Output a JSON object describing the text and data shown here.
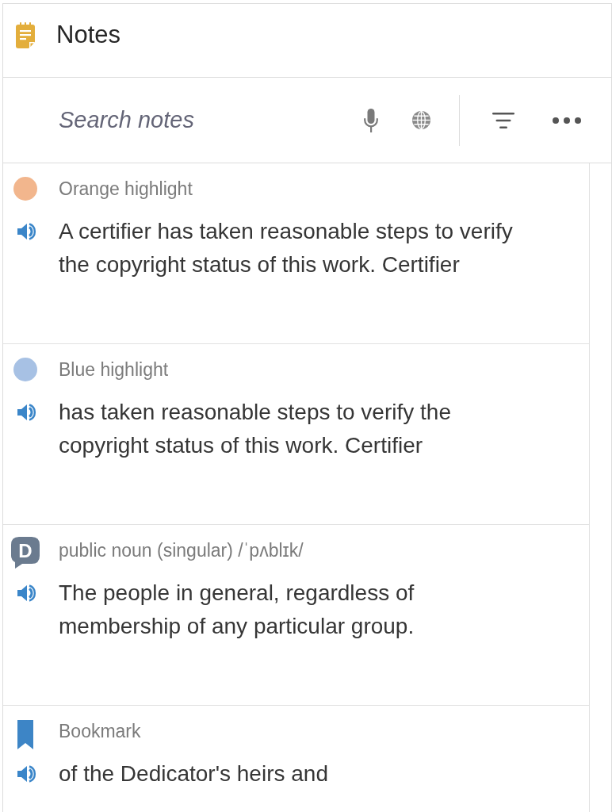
{
  "header": {
    "title": "Notes"
  },
  "search": {
    "placeholder": "Search notes"
  },
  "notes": [
    {
      "kind": "highlight",
      "color": "#f2b68d",
      "label": "Orange highlight",
      "text": "A certifier has taken reasonable steps to verify the copyright status of this work. Certifier"
    },
    {
      "kind": "highlight",
      "color": "#a7c1e4",
      "label": "Blue highlight",
      "text": "has taken reasonable steps to verify the copyright status of this work. Certifier"
    },
    {
      "kind": "dictionary",
      "icon_letter": "D",
      "label": "public noun (singular) /ˈpʌblɪk/",
      "text": "The people in general, regardless of membership of any particular group."
    },
    {
      "kind": "bookmark",
      "label": "Bookmark",
      "text": "of the Dedicator's heirs and"
    }
  ]
}
